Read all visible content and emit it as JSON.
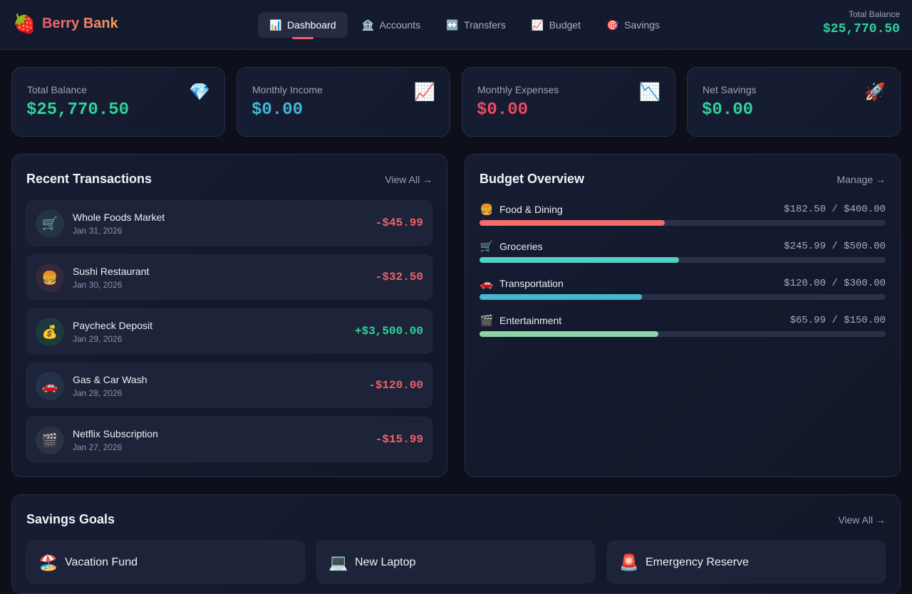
{
  "brand": {
    "icon": "🍓",
    "name": "Berry Bank"
  },
  "nav": [
    {
      "icon": "📊",
      "label": "Dashboard",
      "active": true
    },
    {
      "icon": "🏦",
      "label": "Accounts"
    },
    {
      "icon": "↔️",
      "label": "Transfers"
    },
    {
      "icon": "📈",
      "label": "Budget"
    },
    {
      "icon": "🎯",
      "label": "Savings"
    }
  ],
  "header_balance": {
    "label": "Total Balance",
    "value": "$25,770.50"
  },
  "stats": [
    {
      "label": "Total Balance",
      "value": "$25,770.50",
      "icon": "💎",
      "color": "#2fd39a"
    },
    {
      "label": "Monthly Income",
      "value": "$0.00",
      "icon": "📈",
      "color": "#42b8d8"
    },
    {
      "label": "Monthly Expenses",
      "value": "$0.00",
      "icon": "📉",
      "color": "#ef4a63"
    },
    {
      "label": "Net Savings",
      "value": "$0.00",
      "icon": "🚀",
      "color": "#2fd39a"
    }
  ],
  "transactions": {
    "title": "Recent Transactions",
    "link": "View All →",
    "items": [
      {
        "icon": "🛒",
        "name": "Whole Foods Market",
        "date": "Jan 31, 2026",
        "amount": "-$45.99",
        "color": "#f0606a",
        "icon_bg": "#243442"
      },
      {
        "icon": "🍔",
        "name": "Sushi Restaurant",
        "date": "Jan 30, 2026",
        "amount": "-$32.50",
        "color": "#f0606a",
        "icon_bg": "#35283a"
      },
      {
        "icon": "💰",
        "name": "Paycheck Deposit",
        "date": "Jan 29, 2026",
        "amount": "+$3,500.00",
        "color": "#2fd39a",
        "icon_bg": "#1f3a3d"
      },
      {
        "icon": "🚗",
        "name": "Gas & Car Wash",
        "date": "Jan 28, 2026",
        "amount": "-$120.00",
        "color": "#f0606a",
        "icon_bg": "#243247"
      },
      {
        "icon": "🎬",
        "name": "Netflix Subscription",
        "date": "Jan 27, 2026",
        "amount": "-$15.99",
        "color": "#f0606a",
        "icon_bg": "#2c3244"
      }
    ]
  },
  "budget": {
    "title": "Budget Overview",
    "link": "Manage →",
    "items": [
      {
        "icon": "🍔",
        "name": "Food & Dining",
        "amount": "$182.50 / $400.00",
        "progress": 0.456,
        "color": "#f36b6b"
      },
      {
        "icon": "🛒",
        "name": "Groceries",
        "amount": "$245.99 / $500.00",
        "progress": 0.492,
        "color": "#4fd1c5"
      },
      {
        "icon": "🚗",
        "name": "Transportation",
        "amount": "$120.00 / $300.00",
        "progress": 0.4,
        "color": "#45b7d1"
      },
      {
        "icon": "🎬",
        "name": "Entertainment",
        "amount": "$65.99 / $150.00",
        "progress": 0.44,
        "color": "#8fd3a8"
      }
    ]
  },
  "savings": {
    "title": "Savings Goals",
    "link": "View All →",
    "goals": [
      {
        "icon": "🏖️",
        "name": "Vacation Fund"
      },
      {
        "icon": "💻",
        "name": "New Laptop"
      },
      {
        "icon": "🚨",
        "name": "Emergency Reserve"
      }
    ]
  }
}
